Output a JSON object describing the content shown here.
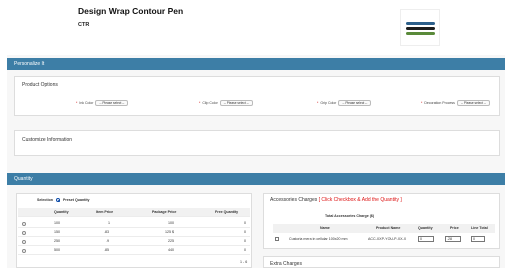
{
  "product": {
    "title": "Design Wrap Contour Pen",
    "code": "CTR"
  },
  "colors": {
    "section_bar": "#3d7ea6",
    "required_star": "#cc0000",
    "accessories_note": "#dd1111",
    "pens": [
      "#2c5f8a",
      "#1c1c1c",
      "#5a8a3a"
    ]
  },
  "sections": {
    "personalize": "Personalize It",
    "quantity": "Quantity"
  },
  "product_options": {
    "title": "Product Options",
    "fields": [
      {
        "label": "Ink Color",
        "value": "-- Please select --"
      },
      {
        "label": "Clip Color",
        "value": "-- Please select --"
      },
      {
        "label": "Grip Color",
        "value": "-- Please select --"
      },
      {
        "label": "Decoration Process",
        "value": "-- Please select --"
      }
    ]
  },
  "customize": {
    "title": "Customize Information"
  },
  "quantity_table": {
    "selection_label": "Selection",
    "preset_label": "Preset Quantity",
    "headers": [
      "Quantity",
      "Item Price",
      "Package Price",
      "Free Quantity"
    ],
    "rows": [
      {
        "qty": "100",
        "item": "1",
        "package": "100",
        "free": "0"
      },
      {
        "qty": "150",
        "item": ".83",
        "package": "125 $",
        "free": "0"
      },
      {
        "qty": "250",
        "item": ".9",
        "package": "225",
        "free": "0"
      },
      {
        "qty": "500",
        "item": ".85",
        "package": "440",
        "free": "0"
      }
    ],
    "pagination": "1 - 6"
  },
  "accessories": {
    "title": "Accessories Charges",
    "note": "[ Click Checkbox & Add the Quantity ]",
    "total_label": "Total Accessories Charge ($)",
    "headers": [
      "Name",
      "Product Name",
      "Quantity",
      "Price",
      "Line Total"
    ],
    "row": {
      "name": "Custoria mera in cellular 100x20 mm",
      "product_name": "ACC-XXP-YOU-P-XX-X",
      "quantity": "0",
      "price": ".28",
      "line_total": "0"
    }
  },
  "extra_charges": {
    "title": "Extra Charges"
  }
}
